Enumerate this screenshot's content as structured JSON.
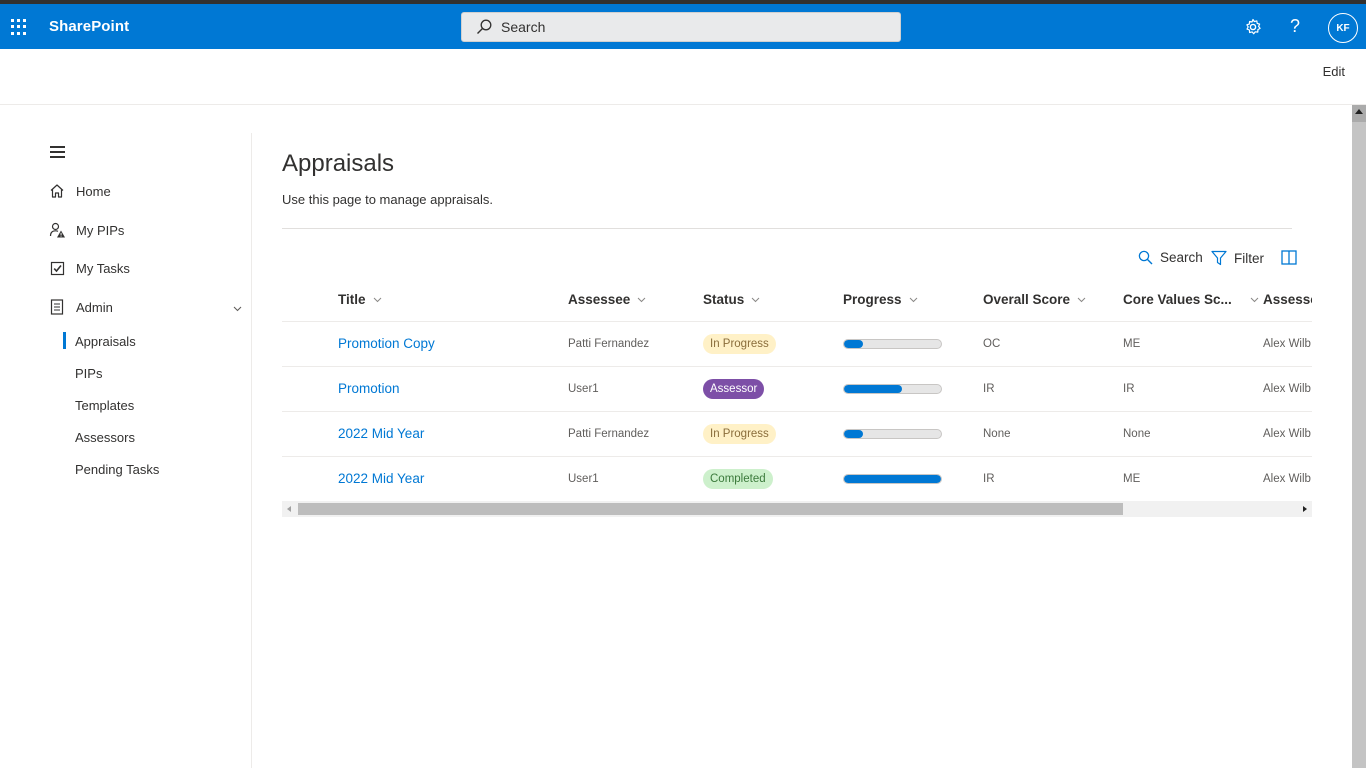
{
  "colors": {
    "brand": "#0078d4",
    "text": "#323130",
    "inprogress_bg": "#fff1c7",
    "inprogress_fg": "#8a6d3b",
    "assessor_bg": "#7d4fa7",
    "assessor_fg": "#ffffff",
    "completed_bg": "#cdf0cc",
    "completed_fg": "#3b7a3b"
  },
  "suitebar": {
    "app_name": "SharePoint",
    "search_placeholder": "Search",
    "help_label": "?",
    "avatar_initials": "KF",
    "icons": {
      "waffle": "app-launcher-icon",
      "search": "search-icon",
      "settings": "gear-icon",
      "help": "help-icon"
    }
  },
  "commandbar": {
    "edit_label": "Edit"
  },
  "nav": {
    "items": [
      {
        "label": "Home",
        "icon": "home-icon"
      },
      {
        "label": "My PIPs",
        "icon": "person-warning-icon"
      },
      {
        "label": "My Tasks",
        "icon": "checkbox-icon"
      },
      {
        "label": "Admin",
        "icon": "document-icon"
      }
    ],
    "admin_children": [
      {
        "label": "Appraisals",
        "selected": true
      },
      {
        "label": "PIPs"
      },
      {
        "label": "Templates"
      },
      {
        "label": "Assessors"
      },
      {
        "label": "Pending Tasks"
      }
    ]
  },
  "page": {
    "title": "Appraisals",
    "description": "Use this page to manage appraisals."
  },
  "toolbar": {
    "search_label": "Search",
    "filter_label": "Filter"
  },
  "table": {
    "columns": [
      "Title",
      "Assessee",
      "Status",
      "Progress",
      "Overall Score",
      "Core Values Sc...",
      "Assesso"
    ],
    "rows": [
      {
        "title": "Promotion Copy",
        "assessee": "Patti Fernandez",
        "status": "In Progress",
        "status_type": "inprogress",
        "progress": 0.2,
        "overall": "OC",
        "core": "ME",
        "assessor": "Alex Wilb"
      },
      {
        "title": "Promotion",
        "assessee": "User1",
        "status": "Assessor",
        "status_type": "assessor",
        "progress": 0.6,
        "overall": "IR",
        "core": "IR",
        "assessor": "Alex Wilb"
      },
      {
        "title": "2022 Mid Year",
        "assessee": "Patti Fernandez",
        "status": "In Progress",
        "status_type": "inprogress",
        "progress": 0.2,
        "overall": "None",
        "core": "None",
        "assessor": "Alex Wilb"
      },
      {
        "title": "2022 Mid Year",
        "assessee": "User1",
        "status": "Completed",
        "status_type": "completed",
        "progress": 1.0,
        "overall": "IR",
        "core": "ME",
        "assessor": "Alex Wilb"
      }
    ]
  }
}
